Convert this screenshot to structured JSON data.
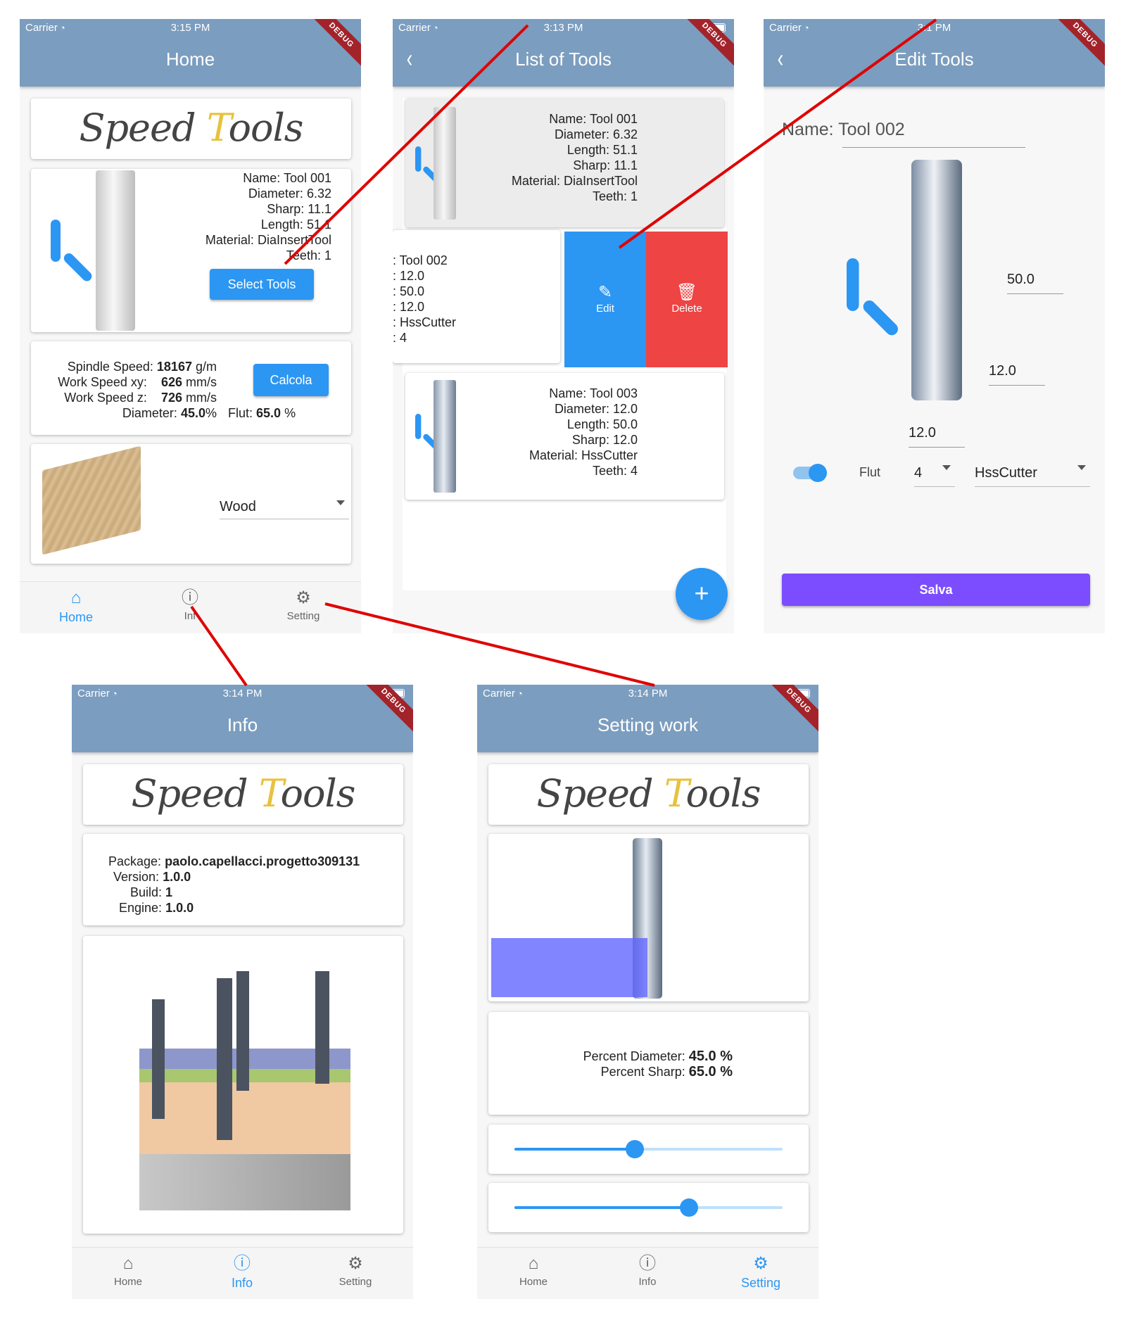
{
  "status": {
    "carrier": "Carrier",
    "time_home": "3:15 PM",
    "time_list": "3:13 PM",
    "time_edit": "3:1 PM",
    "time_info": "3:14 PM",
    "time_setting": "3:14 PM",
    "debug": "DEBUG"
  },
  "logo": {
    "part1": "Speed",
    "part2": "ools",
    "t_letter": "T"
  },
  "nav": {
    "home": "Home",
    "info": "Info",
    "info_short": "Inf",
    "setting": "Setting"
  },
  "home": {
    "title": "Home",
    "tool": {
      "name_label": "Name:",
      "name": "Tool 001",
      "diameter_label": "Diameter:",
      "diameter": "6.32",
      "sharp_label": "Sharp:",
      "sharp": "11.1",
      "length_label": "Length:",
      "length": "51.1",
      "material_label": "Material:",
      "material": "DiaInsertTool",
      "teeth_label": "Teeth:",
      "teeth": "1"
    },
    "select_button": "Select Tools",
    "calc": {
      "spindle_label": "Spindle Speed:",
      "spindle_value": "18167",
      "spindle_unit": "g/m",
      "wsxy_label": "Work Speed xy:",
      "wsxy_value": "626",
      "wsxy_unit": "mm/s",
      "wsz_label": "Work Speed z:",
      "wsz_value": "726",
      "wsz_unit": "mm/s",
      "diam_label": "Diameter:",
      "diam_value": "45.0",
      "diam_unit": "%",
      "flut_label": "Flut:",
      "flut_value": "65.0",
      "flut_unit": "%"
    },
    "calc_button": "Calcola",
    "material_select": "Wood"
  },
  "list": {
    "title": "List of Tools",
    "tool1": {
      "lines": [
        "Name: Tool 001",
        "Diameter: 6.32",
        "Length: 51.1",
        "Sharp: 11.1",
        "Material: DiaInsertTool",
        "Teeth: 1"
      ]
    },
    "tool2": {
      "lines": [
        ": Tool 002",
        ": 12.0",
        ": 50.0",
        ": 12.0",
        ": HssCutter",
        ": 4"
      ]
    },
    "tool3": {
      "lines": [
        "Name: Tool 003",
        "Diameter: 12.0",
        "Length: 50.0",
        "Sharp: 12.0",
        "Material: HssCutter",
        "Teeth: 4"
      ]
    },
    "edit_action": "Edit",
    "delete_action": "Delete",
    "fab": "+"
  },
  "edit": {
    "title": "Edit Tools",
    "name_value": "Name: Tool 002",
    "length_value": "50.0",
    "sharp_value": "12.0",
    "diameter_value": "12.0",
    "flut_label": "Flut",
    "teeth_select": "4",
    "material_select": "HssCutter",
    "save_button": "Salva",
    "switch_on": true
  },
  "info": {
    "title": "Info",
    "package_label": "Package:",
    "package": "paolo.capellacci.progetto309131",
    "version_label": "Version:",
    "version": "1.0.0",
    "build_label": "Build:",
    "build": "1",
    "engine_label": "Engine:",
    "engine": "1.0.0"
  },
  "setting": {
    "title": "Setting work",
    "pd_label": "Percent Diameter:",
    "pd_value": "45.0 %",
    "ps_label": "Percent Sharp:",
    "ps_value": "65.0 %",
    "slider1": 0.45,
    "slider2": 0.65
  },
  "colors": {
    "appbar": "#7b9dbf",
    "accent": "#2c96f3",
    "delete": "#ee4444",
    "save": "#7c4dff",
    "connector": "#e00000"
  }
}
